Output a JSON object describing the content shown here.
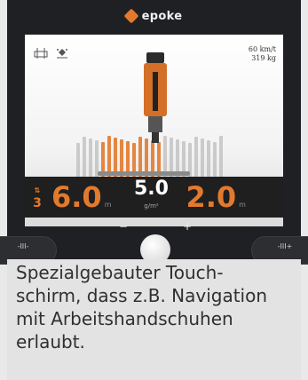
{
  "brand": {
    "name": "epoke"
  },
  "screen": {
    "icons": [
      "road-sign-icon",
      "salt-spreader-icon"
    ],
    "speed": "60 km/t",
    "load": "319 kg"
  },
  "readout": {
    "level": "3",
    "width_left": "6.0",
    "width_left_unit": "m",
    "rate": "5.0",
    "rate_unit": "g/m²",
    "width_right": "2.0",
    "width_right_unit": "m"
  },
  "controls": {
    "left_label": "-III-",
    "right_label": "-III+",
    "minus": "−",
    "plus": "+"
  },
  "colors": {
    "accent": "#e27a2d",
    "panel": "#1f1f1f"
  },
  "caption": {
    "lines": [
      "Spezialgebauter Touch-",
      "schirm, dass z.B. Navigation",
      "mit Arbeitshandschuhen",
      "erlaubt."
    ]
  }
}
